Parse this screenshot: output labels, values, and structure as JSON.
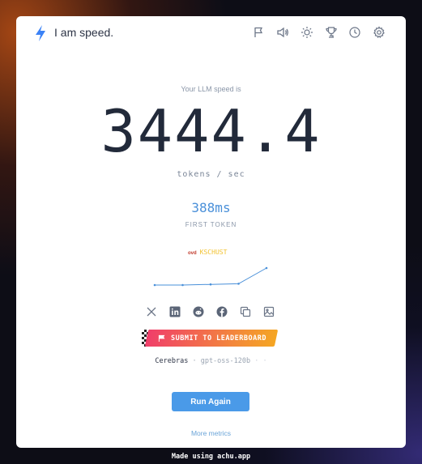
{
  "header": {
    "title": "I am speed.",
    "icons": [
      "flag-icon",
      "volume-icon",
      "sun-icon",
      "trophy-icon",
      "history-icon",
      "settings-icon"
    ]
  },
  "result": {
    "caption": "Your LLM speed is",
    "speed": "3444.4",
    "unit": "tokens / sec",
    "ttft": "388ms",
    "ttft_label": "FIRST TOKEN"
  },
  "sparkline": {
    "legend_logo": "ovd",
    "legend_text": "KSCHUST"
  },
  "chart_data": {
    "type": "line",
    "x": [
      1,
      2,
      3,
      4,
      5
    ],
    "values": [
      2150,
      2150,
      2200,
      2250,
      3444.4
    ]
  },
  "share": {
    "icons": [
      "x-icon",
      "linkedin-icon",
      "reddit-icon",
      "facebook-icon",
      "copy-icon",
      "image-icon"
    ]
  },
  "leaderboard": {
    "button_label": "SUBMIT TO LEADERBOARD"
  },
  "provider_line": {
    "provider": "Cerebras",
    "separator": "·",
    "model": "gpt-oss-120b",
    "trailing": "· ·"
  },
  "actions": {
    "run_again": "Run Again",
    "more_metrics": "More metrics"
  },
  "footer": {
    "text": "Made using achu.app"
  },
  "colors": {
    "accent": "#4a9ae8",
    "ttft": "#4a90d9",
    "leaderboard_start": "#f03e6a",
    "leaderboard_end": "#f5a623"
  }
}
